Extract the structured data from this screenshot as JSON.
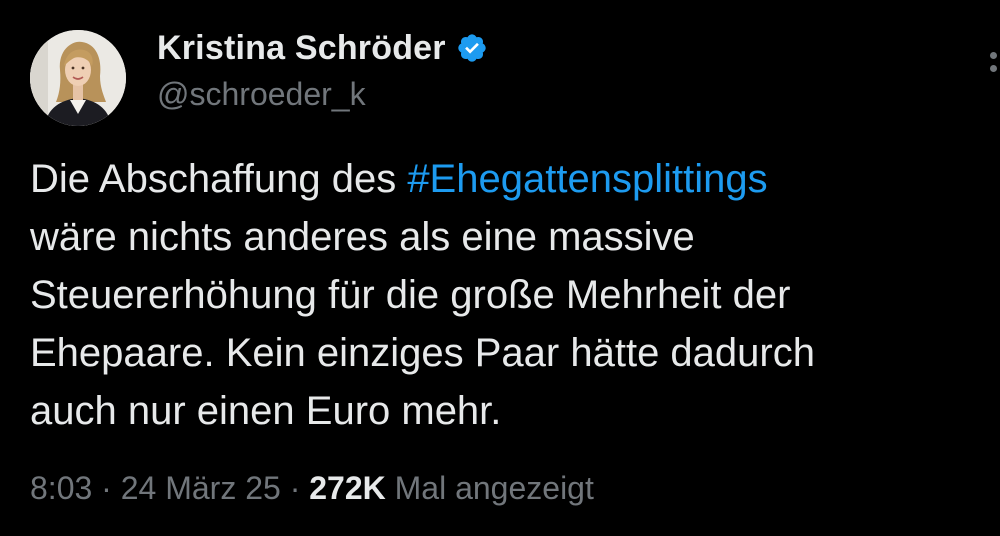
{
  "author": {
    "display_name": "Kristina Schröder",
    "handle": "@schroeder_k",
    "verified": true,
    "avatar_icon": "profile-photo"
  },
  "tweet": {
    "line1_prefix": "Die Abschaffung des ",
    "hashtag": "#Ehegattensplittings",
    "line2": "wäre nichts anderes als eine massive",
    "line3": "Steuererhöhung für die große Mehrheit der",
    "line4": "Ehepaare. Kein einziges Paar hätte dadurch",
    "line5": "auch nur einen Euro mehr."
  },
  "meta": {
    "time": "8:03",
    "sep1": " · ",
    "date": "24 März 25",
    "sep2": " · ",
    "views": "272K",
    "views_label": " Mal angezeigt"
  },
  "colors": {
    "background": "#000000",
    "text": "#e7e9ea",
    "secondary": "#71767b",
    "accent": "#1d9bf0"
  },
  "icons": {
    "verified": "verified-badge-icon",
    "more": "more-options-icon"
  }
}
